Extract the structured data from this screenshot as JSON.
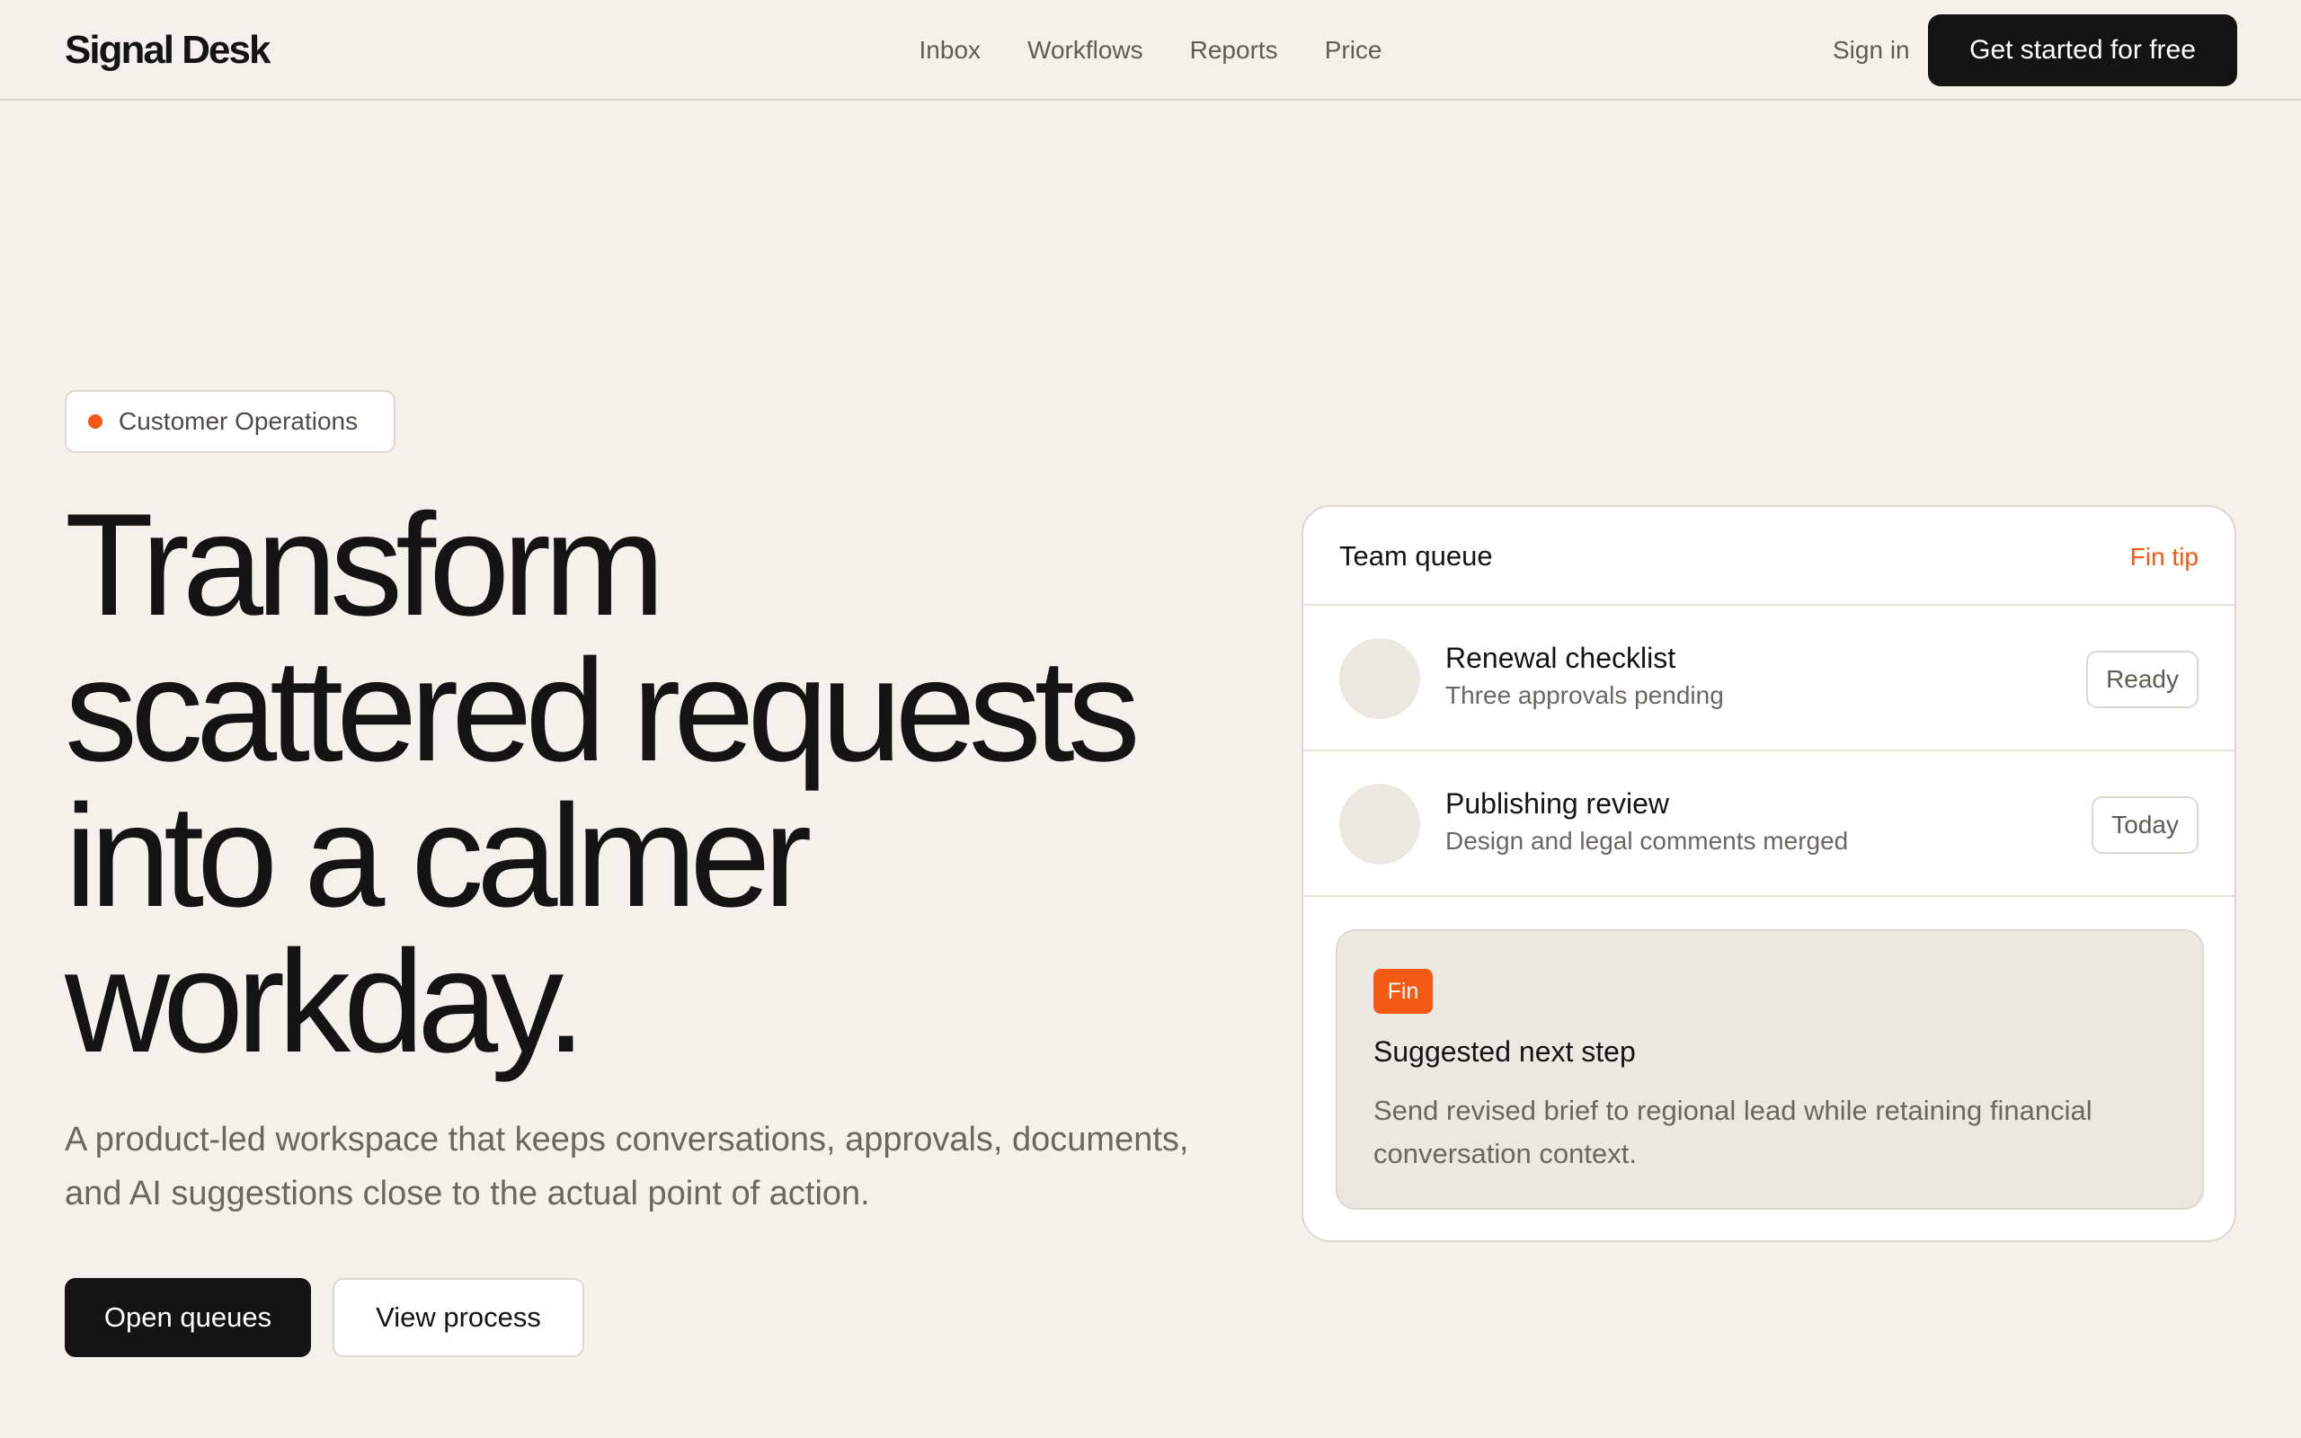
{
  "brand": {
    "name": "Signal Desk",
    "accent": "#f45a14"
  },
  "nav": {
    "items": [
      {
        "label": "Inbox"
      },
      {
        "label": "Workflows"
      },
      {
        "label": "Reports"
      },
      {
        "label": "Price"
      }
    ],
    "sign_in": "Sign in",
    "cta": "Get started for free"
  },
  "hero": {
    "pill_label": "Customer Operations",
    "headline_lines": [
      "Transform",
      "scattered requests",
      "into a calmer",
      "workday."
    ],
    "subtitle": "A product-led workspace that keeps conversations, approvals, documents, and AI suggestions close to the actual point of action.",
    "primary_button": "Open queues",
    "secondary_button": "View process"
  },
  "queue": {
    "title": "Team queue",
    "tip_link": "Fin tip",
    "items": [
      {
        "title": "Renewal checklist",
        "description": "Three approvals pending",
        "badge": "Ready"
      },
      {
        "title": "Publishing review",
        "description": "Design and legal comments merged",
        "badge": "Today"
      }
    ],
    "suggestion": {
      "tag": "Fin",
      "title": "Suggested next step",
      "body": "Send revised brief to regional lead while retaining financial conversation context."
    }
  }
}
